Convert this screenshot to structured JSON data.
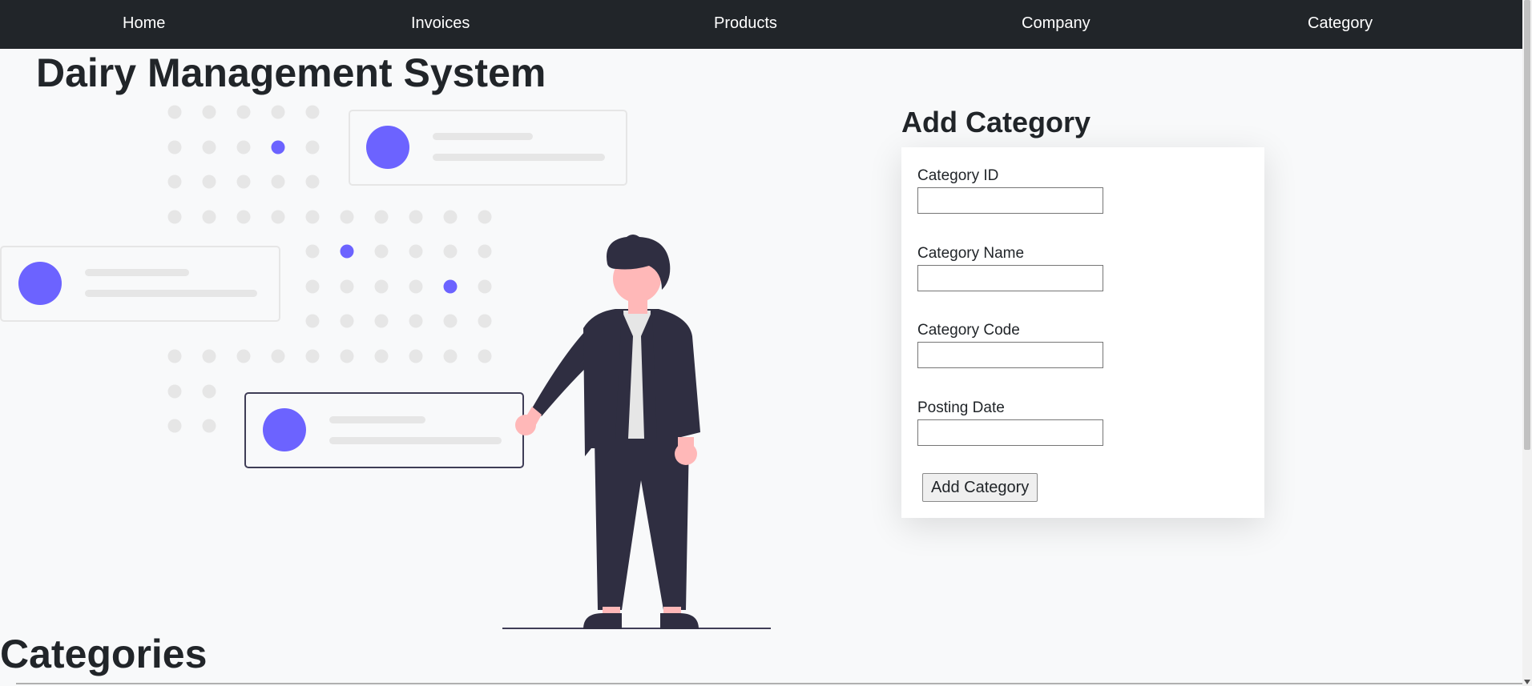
{
  "navbar": {
    "items": [
      {
        "label": "Home"
      },
      {
        "label": "Invoices"
      },
      {
        "label": "Products"
      },
      {
        "label": "Company"
      },
      {
        "label": "Category"
      }
    ]
  },
  "page": {
    "title": "Dairy Management System"
  },
  "form": {
    "heading": "Add Category",
    "fields": [
      {
        "label": "Category ID",
        "value": ""
      },
      {
        "label": "Category Name",
        "value": ""
      },
      {
        "label": "Category Code",
        "value": ""
      },
      {
        "label": "Posting Date",
        "value": ""
      }
    ],
    "submit_label": "Add Category"
  },
  "categories": {
    "title": "Categories"
  },
  "colors": {
    "navbar_bg": "#212529",
    "page_bg": "#f8f9fa",
    "accent": "#6c63ff",
    "figure_dark": "#2f2e41",
    "skin": "#ffb8b8"
  }
}
